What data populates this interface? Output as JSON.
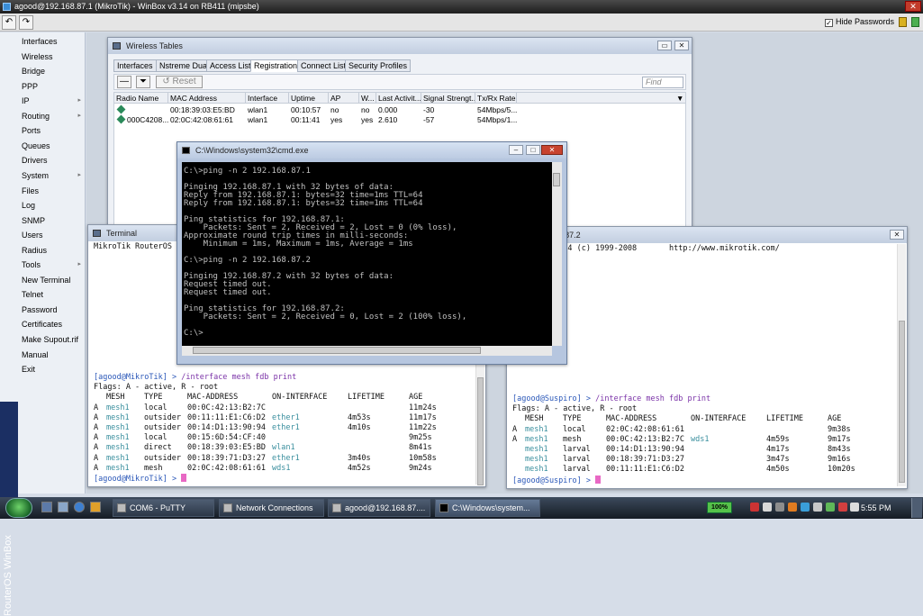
{
  "winbox": {
    "title": "agood@192.168.87.1 (MikroTik) - WinBox v3.14 on RB411 (mipsbe)",
    "undo_icon": "↶",
    "redo_icon": "↷",
    "hide_passwords_label": "Hide Passwords",
    "hide_passwords_checked": "✓",
    "brand": "RouterOS WinBox"
  },
  "sidebar": {
    "items": [
      {
        "label": "Interfaces",
        "arrow": ""
      },
      {
        "label": "Wireless",
        "arrow": ""
      },
      {
        "label": "Bridge",
        "arrow": ""
      },
      {
        "label": "PPP",
        "arrow": ""
      },
      {
        "label": "IP",
        "arrow": "▸"
      },
      {
        "label": "Routing",
        "arrow": "▸"
      },
      {
        "label": "Ports",
        "arrow": ""
      },
      {
        "label": "Queues",
        "arrow": ""
      },
      {
        "label": "Drivers",
        "arrow": ""
      },
      {
        "label": "System",
        "arrow": "▸"
      },
      {
        "label": "Files",
        "arrow": ""
      },
      {
        "label": "Log",
        "arrow": ""
      },
      {
        "label": "SNMP",
        "arrow": ""
      },
      {
        "label": "Users",
        "arrow": ""
      },
      {
        "label": "Radius",
        "arrow": ""
      },
      {
        "label": "Tools",
        "arrow": "▸"
      },
      {
        "label": "New Terminal",
        "arrow": ""
      },
      {
        "label": "Telnet",
        "arrow": ""
      },
      {
        "label": "Password",
        "arrow": ""
      },
      {
        "label": "Certificates",
        "arrow": ""
      },
      {
        "label": "Make Supout.rif",
        "arrow": ""
      },
      {
        "label": "Manual",
        "arrow": ""
      },
      {
        "label": "Exit",
        "arrow": ""
      }
    ]
  },
  "wireless_tables": {
    "title": "Wireless Tables",
    "tabs": [
      "Interfaces",
      "Nstreme Dual",
      "Access List",
      "Registration",
      "Connect List",
      "Security Profiles"
    ],
    "reset_label": "Reset",
    "find_placeholder": "Find",
    "columns": [
      "Radio Name",
      "MAC Address",
      "Interface",
      "Uptime",
      "AP",
      "W...",
      "Last Activit...",
      "Signal Strengt...",
      "Tx/Rx Rate"
    ],
    "rows": [
      [
        "",
        "00:18:39:03:E5:BD",
        "wlan1",
        "00:10:57",
        "no",
        "no",
        "0.000",
        "-30",
        "54Mbps/5..."
      ],
      [
        "000C4208...",
        "02:0C:42:08:61:61",
        "wlan1",
        "00:11:41",
        "yes",
        "yes",
        "2.610",
        "-57",
        "54Mbps/1..."
      ]
    ]
  },
  "terminal1": {
    "title": "Terminal",
    "header": "MikroTik RouterOS",
    "prompt_user": "[agood@MikroTik] >",
    "command": "/interface mesh fdb print",
    "flags": "Flags: A - active, R - root",
    "columns": [
      "MESH",
      "TYPE",
      "MAC-ADDRESS",
      "ON-INTERFACE",
      "LIFETIME",
      "AGE"
    ],
    "rows": [
      {
        "flag": "A",
        "mesh": "mesh1",
        "type": "local",
        "mac": "00:0C:42:13:B2:7C",
        "iface": "",
        "life": "",
        "age": "11m24s"
      },
      {
        "flag": "A",
        "mesh": "mesh1",
        "type": "outsider",
        "mac": "00:11:11:E1:C6:D2",
        "iface": "ether1",
        "life": "4m53s",
        "age": "11m17s"
      },
      {
        "flag": "A",
        "mesh": "mesh1",
        "type": "outsider",
        "mac": "00:14:D1:13:90:94",
        "iface": "ether1",
        "life": "4m10s",
        "age": "11m22s"
      },
      {
        "flag": "A",
        "mesh": "mesh1",
        "type": "local",
        "mac": "00:15:6D:54:CF:40",
        "iface": "",
        "life": "",
        "age": "9m25s"
      },
      {
        "flag": "A",
        "mesh": "mesh1",
        "type": "direct",
        "mac": "00:18:39:03:E5:BD",
        "iface": "wlan1",
        "life": "",
        "age": "8m41s"
      },
      {
        "flag": "A",
        "mesh": "mesh1",
        "type": "outsider",
        "mac": "00:18:39:71:D3:27",
        "iface": "ether1",
        "life": "3m40s",
        "age": "10m58s"
      },
      {
        "flag": "A",
        "mesh": "mesh1",
        "type": "mesh",
        "mac": "02:0C:42:08:61:61",
        "iface": "wds1",
        "life": "4m52s",
        "age": "9m24s"
      }
    ],
    "final_prompt": "[agood@MikroTik] >"
  },
  "terminal2": {
    "title": "@192.168.87.2",
    "header": "RouterOS 3.14 (c) 1999-2008       http://www.mikrotik.com/",
    "prompt_user": "[agood@Suspiro] >",
    "command": "/interface mesh fdb print",
    "flags": "Flags: A - active, R - root",
    "columns": [
      "MESH",
      "TYPE",
      "MAC-ADDRESS",
      "ON-INTERFACE",
      "LIFETIME",
      "AGE"
    ],
    "rows": [
      {
        "flag": "A",
        "mesh": "mesh1",
        "type": "local",
        "mac": "02:0C:42:08:61:61",
        "iface": "",
        "life": "",
        "age": "9m38s"
      },
      {
        "flag": "A",
        "mesh": "mesh1",
        "type": "mesh",
        "mac": "00:0C:42:13:B2:7C",
        "iface": "wds1",
        "life": "4m59s",
        "age": "9m17s"
      },
      {
        "flag": "",
        "mesh": "mesh1",
        "type": "larval",
        "mac": "00:14:D1:13:90:94",
        "iface": "",
        "life": "4m17s",
        "age": "8m43s"
      },
      {
        "flag": "",
        "mesh": "mesh1",
        "type": "larval",
        "mac": "00:18:39:71:D3:27",
        "iface": "",
        "life": "3m47s",
        "age": "9m16s"
      },
      {
        "flag": "",
        "mesh": "mesh1",
        "type": "larval",
        "mac": "00:11:11:E1:C6:D2",
        "iface": "",
        "life": "4m50s",
        "age": "10m20s"
      }
    ],
    "final_prompt": "[agood@Suspiro] >"
  },
  "cmd": {
    "title": "C:\\Windows\\system32\\cmd.exe",
    "lines": [
      "C:\\>ping -n 2 192.168.87.1",
      "",
      "Pinging 192.168.87.1 with 32 bytes of data:",
      "Reply from 192.168.87.1: bytes=32 time=1ms TTL=64",
      "Reply from 192.168.87.1: bytes=32 time=1ms TTL=64",
      "",
      "Ping statistics for 192.168.87.1:",
      "    Packets: Sent = 2, Received = 2, Lost = 0 (0% loss),",
      "Approximate round trip times in milli-seconds:",
      "    Minimum = 1ms, Maximum = 1ms, Average = 1ms",
      "",
      "C:\\>ping -n 2 192.168.87.2",
      "",
      "Pinging 192.168.87.2 with 32 bytes of data:",
      "Request timed out.",
      "Request timed out.",
      "",
      "Ping statistics for 192.168.87.2:",
      "    Packets: Sent = 2, Received = 0, Lost = 2 (100% loss),",
      "",
      "C:\\>"
    ]
  },
  "taskbar": {
    "tasks": [
      "COM6 - PuTTY",
      "Network Connections",
      "agood@192.168.87....",
      "C:\\Windows\\system..."
    ],
    "battery": "100%",
    "clock": "5:55 PM"
  },
  "colors": {
    "brand": "#1b2f63",
    "link": "#2a57b8",
    "cursor": "#e868c4"
  }
}
